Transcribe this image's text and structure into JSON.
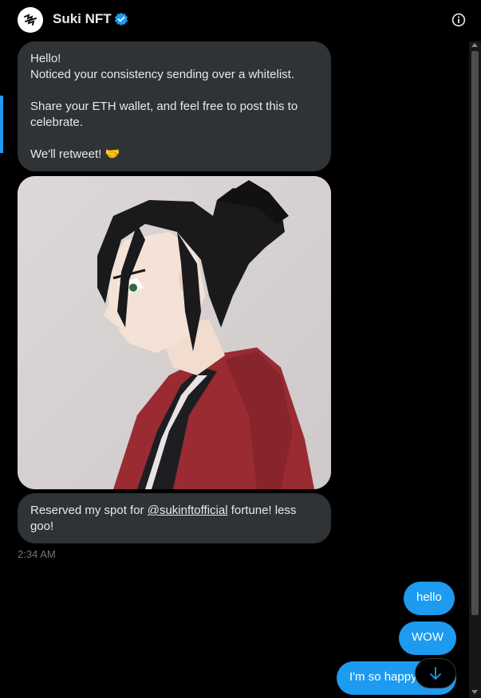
{
  "header": {
    "title": "Suki NFT",
    "avatar_icon": "suki-logo-icon",
    "verified_icon": "verified-badge-icon",
    "info_icon": "info-icon"
  },
  "messages": {
    "received": {
      "line1": "Hello!",
      "line2": "Noticed your consistency sending over a whitelist.",
      "line3": "Share your ETH wallet, and feel free to post this to celebrate.",
      "line4": "We'll retweet! 🤝",
      "image_icon": "anime-samurai-portrait-image",
      "caption_prefix": "Reserved my spot for ",
      "caption_mention": "@sukinftofficial",
      "caption_suffix": " fortune! less goo!",
      "time": "2:34 AM"
    },
    "sent": [
      {
        "text": "hello"
      },
      {
        "text": "WOW"
      },
      {
        "text": "I'm so happy"
      }
    ]
  },
  "scroll_down_icon": "arrow-down-icon",
  "colors": {
    "accent": "#1d9bf0",
    "bubble_in": "#2f3336",
    "background": "#000000"
  }
}
